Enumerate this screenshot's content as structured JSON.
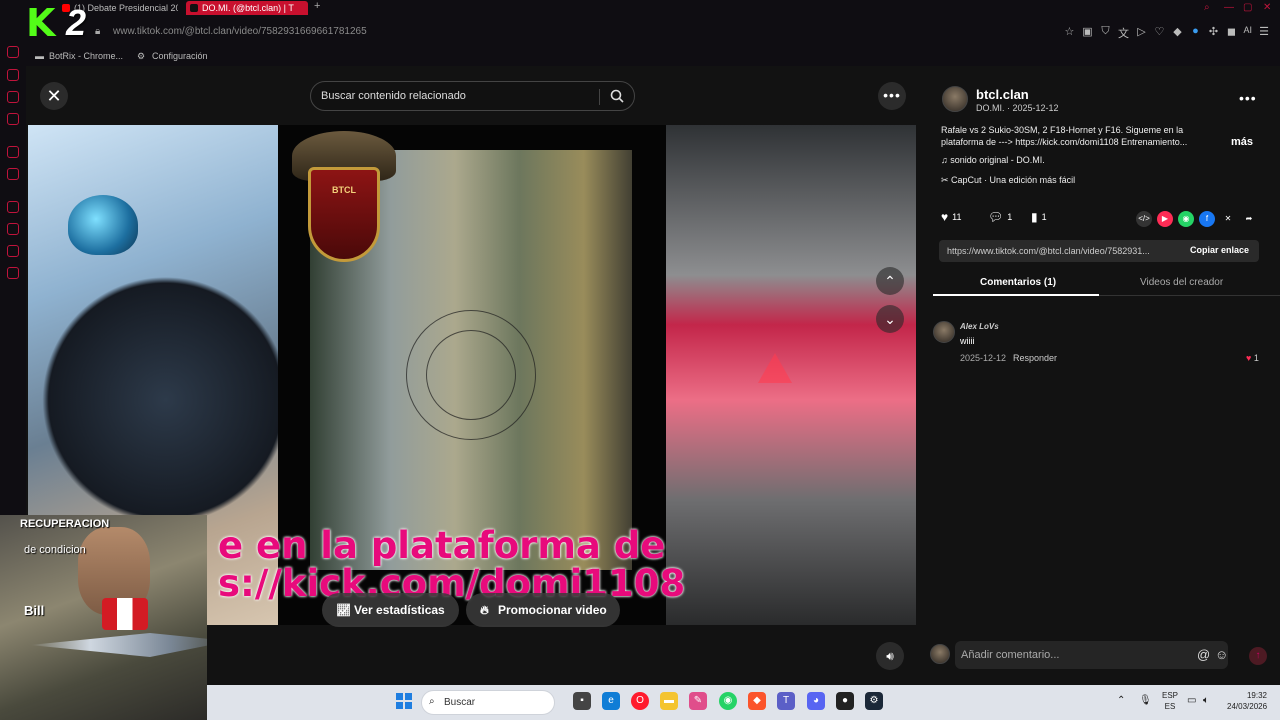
{
  "browser": {
    "tabs": [
      {
        "label": "(1) Debate Presidencial 20"
      },
      {
        "label": "DO.MI. (@btcl.clan) | T"
      }
    ],
    "new_tab": "+",
    "url": "www.tiktok.com/@btcl.clan/video/7582931669661781265",
    "bookmarks": [
      {
        "label": "BotRix - Chrome..."
      },
      {
        "label": "Configuración"
      }
    ],
    "ext_ai_label": "AI"
  },
  "logo_overlay": {
    "k": "K",
    "two": "2"
  },
  "viewer": {
    "search_placeholder": "Buscar contenido relacionado",
    "crest_text": "BTCL",
    "subtitle_line1": "e en la plataforma de",
    "subtitle_line2": "s://kick.com/domi1108",
    "stats_label": "Ver estadísticas",
    "promote_label": "Promocionar video"
  },
  "webcam": {
    "line1": "RECUPERACION",
    "line2": "de condicion",
    "name": "Bill"
  },
  "sidebar": {
    "author": "btcl.clan",
    "meta": "DO.MI. · 2025-12-12",
    "description": "Rafale vs 2 Sukio-30SM, 2 F18-Hornet y F16. Sigueme en la plataforma de ---> https://kick.com/domi1108 Entrenamiento...",
    "more_label": "más",
    "music": "sonido original - DO.MI.",
    "capcut": "CapCut · Una edición más fácil",
    "likes": "11",
    "comments": "1",
    "saves": "1",
    "share_link": "https://www.tiktok.com/@btcl.clan/video/7582931...",
    "copy_label": "Copiar enlace",
    "tab_comments": "Comentarios (1)",
    "tab_creator": "Videos del creador",
    "comment": {
      "user": "Alex LoVs",
      "text": "wiiii",
      "date": "2025-12-12",
      "reply": "Responder",
      "likes": "1"
    },
    "add_comment_placeholder": "Añadir comentario..."
  },
  "taskbar": {
    "search_placeholder": "Buscar",
    "lang_top": "ESP",
    "lang_bottom": "ES",
    "time": "19:32",
    "date": "24/03/2026"
  },
  "colors": {
    "opera_red": "#c0143c",
    "active_tab": "#c8102e",
    "kick_green": "#53fc18",
    "tiktok_pink": "#fe2c55"
  }
}
